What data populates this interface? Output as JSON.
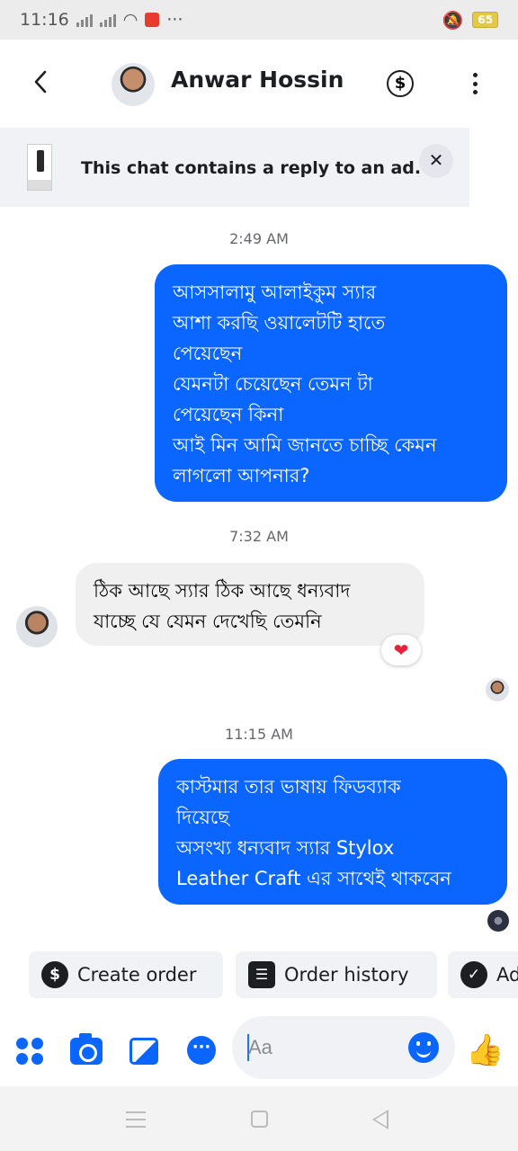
{
  "status_bar": {
    "time": "11:16",
    "battery": "65",
    "overflow": "···"
  },
  "header": {
    "contact_name": "Anwar Hossin"
  },
  "ad_notice": {
    "text": "This chat contains a reply to an ad.",
    "close_glyph": "✕"
  },
  "messages": [
    {
      "timestamp": "2:49 AM",
      "direction": "outgoing",
      "lines": [
        "আসসালামু আলাইকুম স্যার",
        "আশা করছি ওয়ালেটটি হাতে",
        "পেয়েছেন",
        "যেমনটা চেয়েছেন তেমন টা",
        "পেয়েছেন কিনা",
        "আই মিন আমি জানতে চাচ্ছি কেমন",
        "লাগলো আপনার?"
      ]
    },
    {
      "timestamp": "7:32 AM",
      "direction": "incoming",
      "lines": [
        "ঠিক আছে স্যার ঠিক আছে ধন্যবাদ",
        "যাচ্ছে যে যেমন দেখেছি তেমনি"
      ],
      "reaction": "❤"
    },
    {
      "timestamp": "11:15 AM",
      "direction": "outgoing",
      "lines": [
        "কাস্টমার তার ভাষায় ফিডব্যাক",
        "দিয়েছে",
        "অসংখ্য ধন্যবাদ স্যার Stylox",
        "Leather Craft এর সাথেই থাকবেন"
      ]
    }
  ],
  "quick_actions": [
    {
      "label": "Create order",
      "icon": "dollar-icon",
      "glyph": "$"
    },
    {
      "label": "Order history",
      "icon": "list-icon",
      "glyph": "☰"
    },
    {
      "label": "Ad",
      "icon": "check-icon",
      "glyph": "✓"
    }
  ],
  "composer": {
    "placeholder": "Aa",
    "like_glyph": "👍"
  },
  "colors": {
    "accent": "#0a66ff",
    "incoming_bubble": "#f0f0f0",
    "heart": "#e8213b"
  }
}
